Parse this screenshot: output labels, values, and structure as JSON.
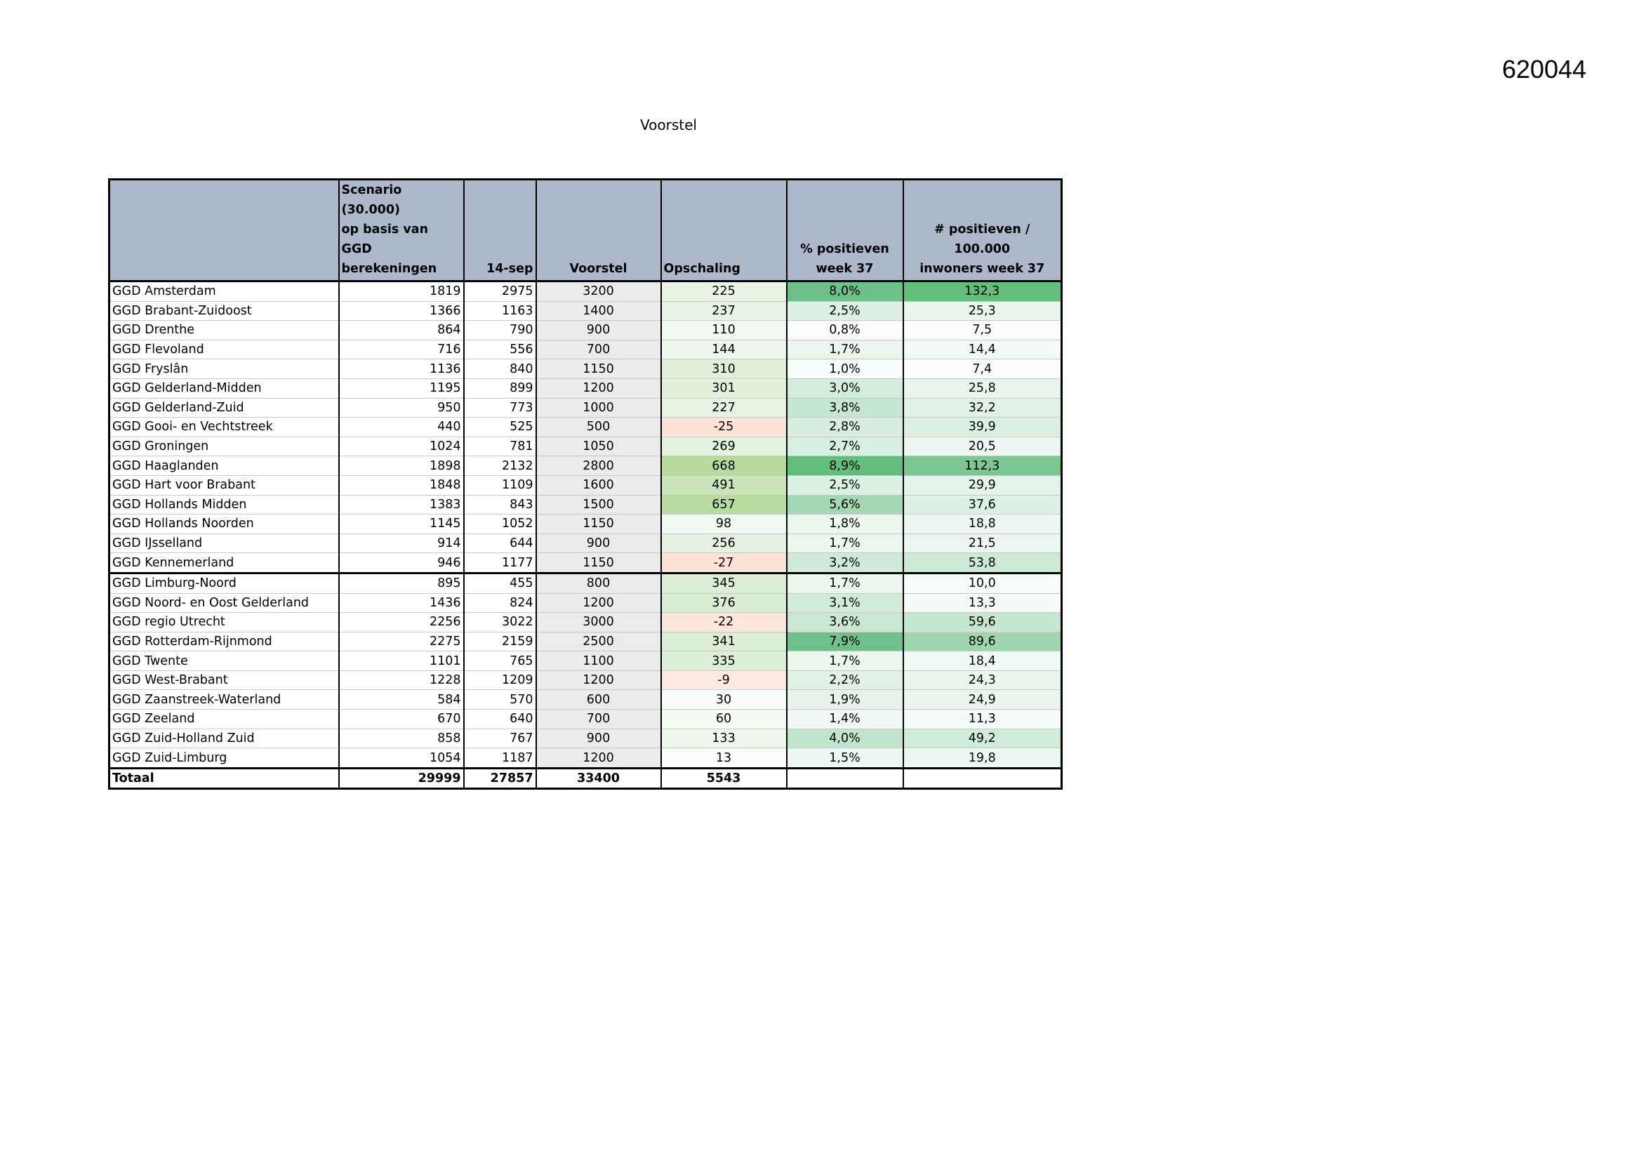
{
  "doc_id": "620044",
  "title": "Voorstel",
  "table": {
    "headers": {
      "region": "",
      "scenario_line1": "Scenario (30.000)",
      "scenario_line2": "op basis van GGD",
      "scenario_line3": "berekeningen",
      "sep14": "14-sep",
      "voorstel": "Voorstel",
      "opschaling": "Opschaling",
      "pct_line1": "% positieven",
      "pct_line2": "week 37",
      "per100k_line1": "# positieven / 100.000",
      "per100k_line2": "inwoners week 37"
    },
    "rows": [
      {
        "name": "GGD Amsterdam",
        "scenario": "1819",
        "sep14": "2975",
        "voorstel": "3200",
        "opschaling": "225",
        "pct": "8,0%",
        "per100k": "132,3",
        "c_ops": "#e9f4e5",
        "c_pct": "#6dc087",
        "c_per": "#63be7b"
      },
      {
        "name": "GGD Brabant-Zuidoost",
        "scenario": "1366",
        "sep14": "1163",
        "voorstel": "1400",
        "opschaling": "237",
        "pct": "2,5%",
        "per100k": "25,3",
        "c_ops": "#e7f3e3",
        "c_pct": "#dbefe2",
        "c_per": "#e8f5ec"
      },
      {
        "name": "GGD Drenthe",
        "scenario": "864",
        "sep14": "790",
        "voorstel": "900",
        "opschaling": "110",
        "pct": "0,8%",
        "per100k": "7,5",
        "c_ops": "#f2f8f1",
        "c_pct": "#fcfcff",
        "c_per": "#fafcfd"
      },
      {
        "name": "GGD Flevoland",
        "scenario": "716",
        "sep14": "556",
        "voorstel": "700",
        "opschaling": "144",
        "pct": "1,7%",
        "per100k": "14,4",
        "c_ops": "#eff7ee",
        "c_pct": "#ebf6ef",
        "c_per": "#f3f9f6"
      },
      {
        "name": "GGD Fryslân",
        "scenario": "1136",
        "sep14": "840",
        "voorstel": "1150",
        "opschaling": "310",
        "pct": "1,0%",
        "per100k": "7,4",
        "c_ops": "#e0f0db",
        "c_pct": "#f8fbfc",
        "c_per": "#fafcfd"
      },
      {
        "name": "GGD Gelderland-Midden",
        "scenario": "1195",
        "sep14": "899",
        "voorstel": "1200",
        "opschaling": "301",
        "pct": "3,0%",
        "per100k": "25,8",
        "c_ops": "#e1f1dc",
        "c_pct": "#d3ecdb",
        "c_per": "#e8f5ec"
      },
      {
        "name": "GGD Gelderland-Zuid",
        "scenario": "950",
        "sep14": "773",
        "voorstel": "1000",
        "opschaling": "227",
        "pct": "3,8%",
        "per100k": "32,2",
        "c_ops": "#e8f4e4",
        "c_pct": "#c5e6d0",
        "c_per": "#e2f2e7"
      },
      {
        "name": "GGD Gooi- en Vechtstreek",
        "scenario": "440",
        "sep14": "525",
        "voorstel": "500",
        "opschaling": "-25",
        "pct": "2,8%",
        "per100k": "39,9",
        "c_ops": "#fce3d6",
        "c_pct": "#d6ede0",
        "c_per": "#dbefe2"
      },
      {
        "name": "GGD Groningen",
        "scenario": "1024",
        "sep14": "781",
        "voorstel": "1050",
        "opschaling": "269",
        "pct": "2,7%",
        "per100k": "20,5",
        "c_ops": "#e4f2e0",
        "c_pct": "#d8eee0",
        "c_per": "#edf7f1"
      },
      {
        "name": "GGD Haaglanden",
        "scenario": "1898",
        "sep14": "2132",
        "voorstel": "2800",
        "opschaling": "668",
        "pct": "8,9%",
        "per100k": "112,3",
        "c_ops": "#b6db9e",
        "c_pct": "#63be7b",
        "c_per": "#7dc792"
      },
      {
        "name": "GGD Hart voor Brabant",
        "scenario": "1848",
        "sep14": "1109",
        "voorstel": "1600",
        "opschaling": "491",
        "pct": "2,5%",
        "per100k": "29,9",
        "c_ops": "#cbe5bb",
        "c_pct": "#dbefe2",
        "c_per": "#e4f3e9"
      },
      {
        "name": "GGD Hollands Midden",
        "scenario": "1383",
        "sep14": "843",
        "voorstel": "1500",
        "opschaling": "657",
        "pct": "5,6%",
        "per100k": "37,6",
        "c_ops": "#b8dca0",
        "c_pct": "#a3d8b4",
        "c_per": "#dcf0e3"
      },
      {
        "name": "GGD Hollands Noorden",
        "scenario": "1145",
        "sep14": "1052",
        "voorstel": "1150",
        "opschaling": "98",
        "pct": "1,8%",
        "per100k": "18,8",
        "c_ops": "#f3f9f2",
        "c_pct": "#eaf6ee",
        "c_per": "#eef7f2"
      },
      {
        "name": "GGD IJsselland",
        "scenario": "914",
        "sep14": "644",
        "voorstel": "900",
        "opschaling": "256",
        "pct": "1,7%",
        "per100k": "21,5",
        "c_ops": "#e5f2e1",
        "c_pct": "#ebf6ef",
        "c_per": "#ecf6f0"
      },
      {
        "name": "GGD Kennemerland",
        "scenario": "946",
        "sep14": "1177",
        "voorstel": "1150",
        "opschaling": "-27",
        "pct": "3,2%",
        "per100k": "53,8",
        "c_ops": "#fce2d5",
        "c_pct": "#cfead8",
        "c_per": "#cbe9d5"
      },
      {
        "name": "GGD Limburg-Noord",
        "scenario": "895",
        "sep14": "455",
        "voorstel": "800",
        "opschaling": "345",
        "pct": "1,7%",
        "per100k": "10,0",
        "c_ops": "#ddeed6",
        "c_pct": "#ebf6ef",
        "c_per": "#f7fbfa"
      },
      {
        "name": "GGD Noord- en Oost Gelderland",
        "scenario": "1436",
        "sep14": "824",
        "voorstel": "1200",
        "opschaling": "376",
        "pct": "3,1%",
        "per100k": "13,3",
        "c_ops": "#daedd2",
        "c_pct": "#d1ebd9",
        "c_per": "#f4f9f7"
      },
      {
        "name": "GGD regio Utrecht",
        "scenario": "2256",
        "sep14": "3022",
        "voorstel": "3000",
        "opschaling": "-22",
        "pct": "3,6%",
        "per100k": "59,6",
        "c_ops": "#fce5d9",
        "c_pct": "#c8e8d2",
        "c_per": "#c5e6d0"
      },
      {
        "name": "GGD Rotterdam-Rijnmond",
        "scenario": "2275",
        "sep14": "2159",
        "voorstel": "2500",
        "opschaling": "341",
        "pct": "7,9%",
        "per100k": "89,6",
        "c_ops": "#ddeed6",
        "c_pct": "#70c189",
        "c_per": "#9ed6af"
      },
      {
        "name": "GGD Twente",
        "scenario": "1101",
        "sep14": "765",
        "voorstel": "1100",
        "opschaling": "335",
        "pct": "1,7%",
        "per100k": "18,4",
        "c_ops": "#deefd8",
        "c_pct": "#ebf6ef",
        "c_per": "#eff8f3"
      },
      {
        "name": "GGD West-Brabant",
        "scenario": "1228",
        "sep14": "1209",
        "voorstel": "1200",
        "opschaling": "-9",
        "pct": "2,2%",
        "per100k": "24,3",
        "c_ops": "#fde9df",
        "c_pct": "#e1f1e6",
        "c_per": "#e9f5ed"
      },
      {
        "name": "GGD Zaanstreek-Waterland",
        "scenario": "584",
        "sep14": "570",
        "voorstel": "600",
        "opschaling": "30",
        "pct": "1,9%",
        "per100k": "24,9",
        "c_ops": "#f9fcf8",
        "c_pct": "#e7f4eb",
        "c_per": "#e9f5ed"
      },
      {
        "name": "GGD Zeeland",
        "scenario": "670",
        "sep14": "640",
        "voorstel": "700",
        "opschaling": "60",
        "pct": "1,4%",
        "per100k": "11,3",
        "c_ops": "#f7fbf5",
        "c_pct": "#f0f8f3",
        "c_per": "#f6fafa"
      },
      {
        "name": "GGD Zuid-Holland Zuid",
        "scenario": "858",
        "sep14": "767",
        "voorstel": "900",
        "opschaling": "133",
        "pct": "4,0%",
        "per100k": "49,2",
        "c_ops": "#f0f8ee",
        "c_pct": "#c1e4cc",
        "c_per": "#d0ebd9"
      },
      {
        "name": "GGD Zuid-Limburg",
        "scenario": "1054",
        "sep14": "1187",
        "voorstel": "1200",
        "opschaling": "13",
        "pct": "1,5%",
        "per100k": "19,8",
        "c_ops": "#fbfdfa",
        "c_pct": "#eef7f2",
        "c_per": "#edf7f1"
      }
    ],
    "total": {
      "name": "Totaal",
      "scenario": "29999",
      "sep14": "27857",
      "voorstel": "33400",
      "opschaling": "5543",
      "pct": "",
      "per100k": ""
    }
  }
}
